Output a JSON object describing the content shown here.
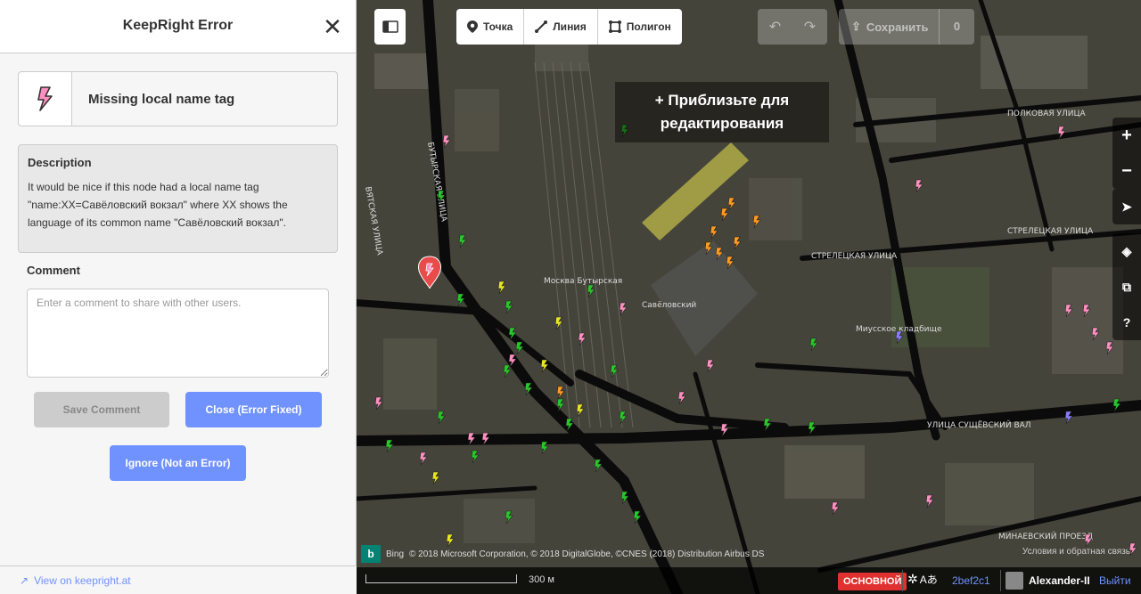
{
  "sidebar": {
    "title": "KeepRight Error",
    "issue_label": "Missing local name tag",
    "description_heading": "Description",
    "description_text": "It would be nice if this node had a local name tag \"name:XX=Савёловский вокзал\" where XX shows the language of its common name \"Савёловский вокзал\".",
    "comment_heading": "Comment",
    "comment_placeholder": "Enter a comment to share with other users.",
    "save_comment": "Save Comment",
    "close_error": "Close (Error Fixed)",
    "ignore_error": "Ignore (Not an Error)",
    "footer_link": "View on keepright.at"
  },
  "toolbar": {
    "modes": [
      "Точка",
      "Линия",
      "Полигон"
    ],
    "save_label": "Сохранить",
    "save_count": "0"
  },
  "map": {
    "zoom_notice": "Приблизьте для редактирования",
    "attribution": "© 2018 Microsoft Corporation, © 2018 DigitalGlobe, ©CNES (2018) Distribution Airbus DS",
    "bing_label": "Bing",
    "help_link": "Условия и обратная связь",
    "streets": {
      "s1": "ПОЛКОВАЯ УЛИЦА",
      "s2": "СТРЕЛЕЦКАЯ УЛИЦА",
      "s3": "УЛИЦА СУЩЁВСКИЙ ВАЛ",
      "s4": "БУТЫРСКАЯ УЛИЦА",
      "s5": "ВЯТСКАЯ УЛИЦА",
      "s6": "МИНАЕВСКИЙ ПРОЕЗД",
      "s7": "Москва Бутырская",
      "s8": "Савёловский",
      "s9": "Миусское кладбище",
      "s10": "СТРЕЛЕЦКАЯ УЛИЦА"
    }
  },
  "footer": {
    "scale": "300 м",
    "badge": "ОСНОВНОЙ",
    "version": "2bef2c1",
    "user": "Alexander-II",
    "logout": "Выйти"
  },
  "colors": {
    "accent": "#7092ff",
    "issue_marker": "#e94b4b",
    "marker_green": "#28c828",
    "marker_pink": "#ff8fc0",
    "marker_orange": "#ff9a22",
    "marker_yellow": "#e8e820",
    "marker_purple": "#8a7cff"
  }
}
